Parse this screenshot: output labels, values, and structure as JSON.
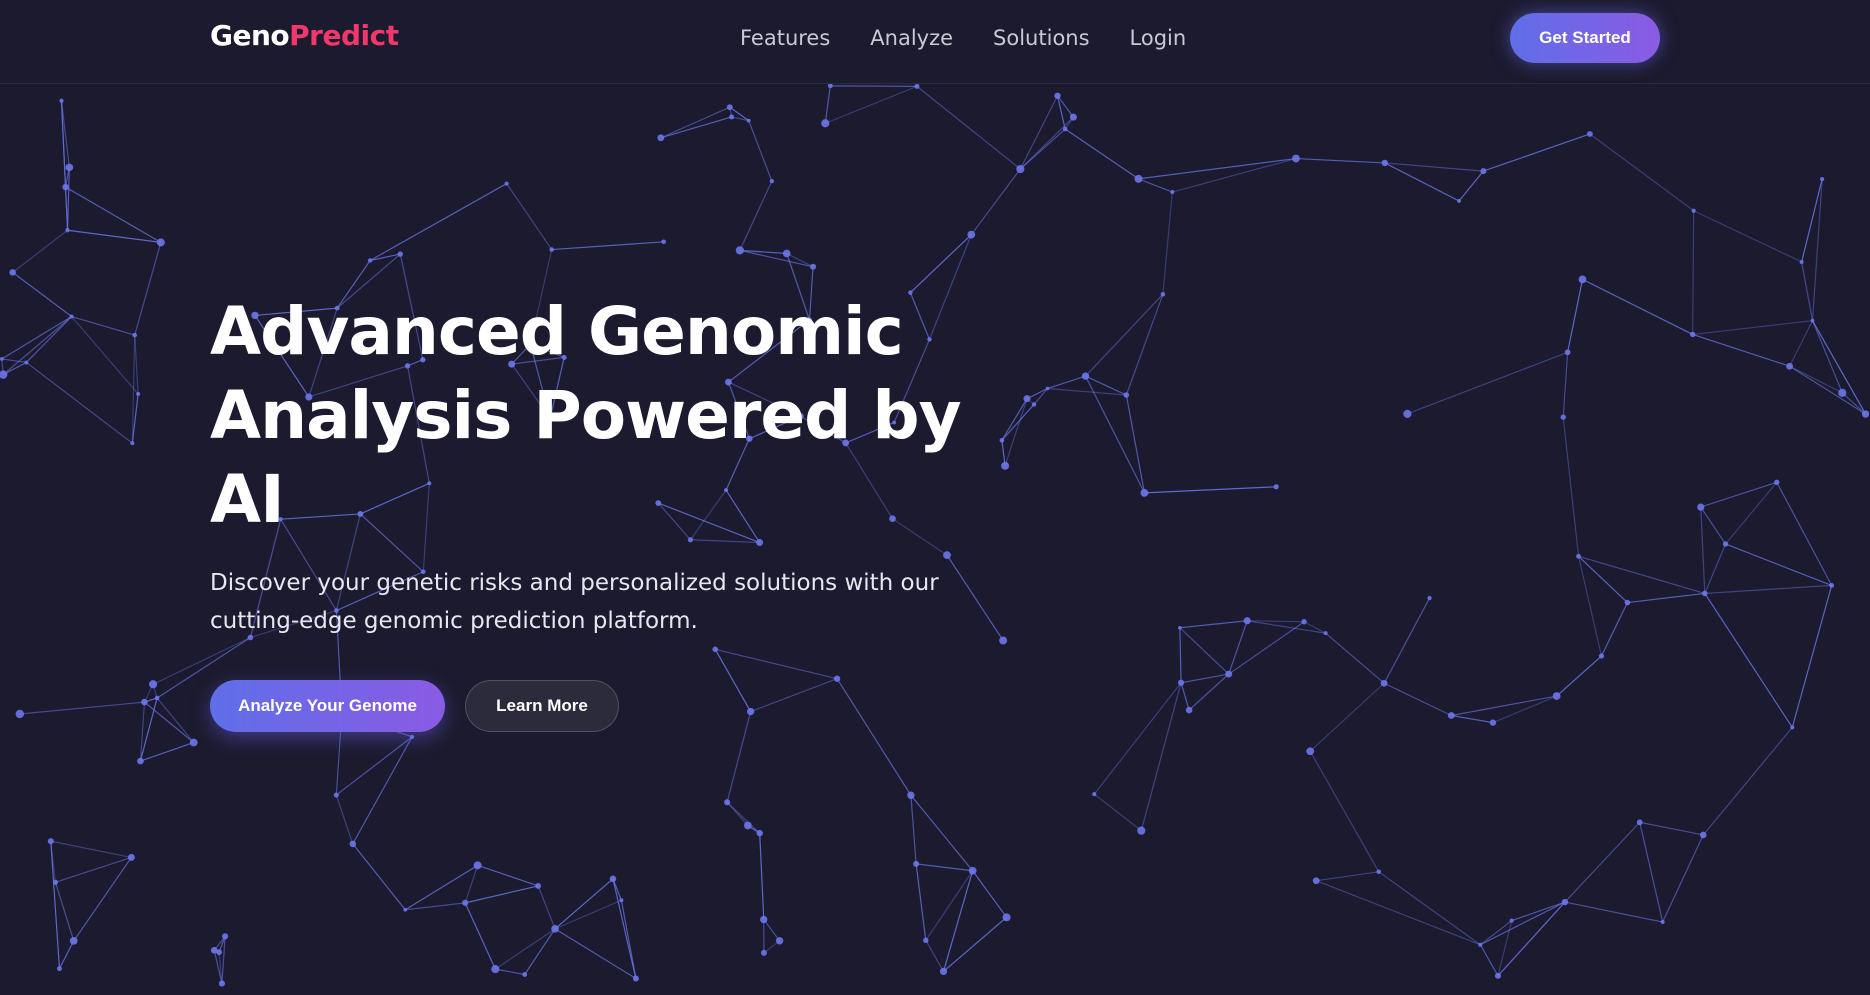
{
  "brand": {
    "name_part1": "Geno",
    "name_part2": "Predict"
  },
  "nav": {
    "links": [
      "Features",
      "Analyze",
      "Solutions",
      "Login"
    ],
    "cta": "Get Started"
  },
  "hero": {
    "title_line1": "Advanced Genomic",
    "title_line2": "Analysis Powered by",
    "title_line3": "AI",
    "subtitle": "Discover your genetic risks and personalized solutions with our cutting-edge genomic prediction platform.",
    "primary_button": "Analyze Your Genome",
    "secondary_button": "Learn More"
  },
  "colors": {
    "background": "#1b1a2e",
    "accent_gradient_start": "#5f6ee8",
    "accent_gradient_end": "#8a5be4",
    "brand_highlight": "#f0386b",
    "network_line": "#6b77ea"
  }
}
